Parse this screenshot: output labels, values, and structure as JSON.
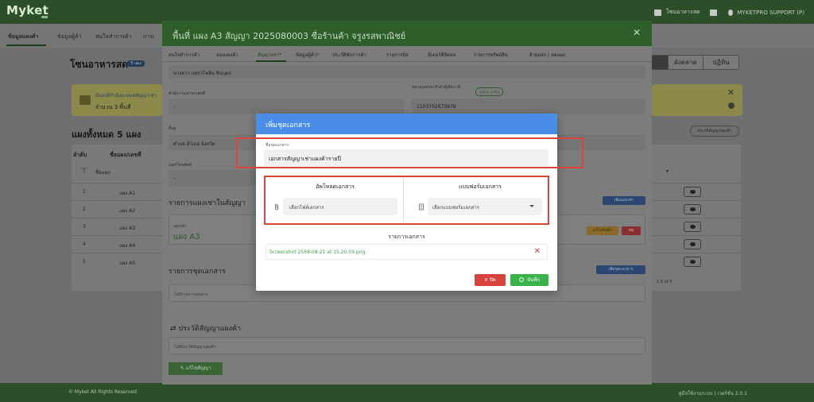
{
  "app": {
    "logo": "Myket",
    "user_label": "โซนอาหารสด",
    "account_label": "MYKETPRO SUPPORT (P)"
  },
  "page_tabs": [
    "ข้อมูลแผงค้า",
    "ข้อมูลผู้ค้า",
    "สนใจทำการค้า",
    "การเ"
  ],
  "page": {
    "title": "โซนอาหารสด",
    "badge": "5 แผง",
    "view_buttons": [
      "",
      "ผังตลาด",
      "ปฏิทิน"
    ],
    "banner_line1": "มีแผงที่กำลังจะหมดสัญญาเช่า",
    "banner_line2": "จำนวน 3 พื้นที่",
    "stalls_title": "แผงทั้งหมด 5 แผง",
    "history_button": "ประวัติสัญญาแผงค้า",
    "table_headers": [
      "ลำดับ",
      "ชื่อแผง/เลขที่"
    ],
    "filter_placeholder": "ชื่อแผง",
    "rows": [
      {
        "num": "1",
        "name": "แผง A1"
      },
      {
        "num": "2",
        "name": "แผง A2"
      },
      {
        "num": "3",
        "name": "แผง A3"
      },
      {
        "num": "4",
        "name": "แผง A4"
      },
      {
        "num": "5",
        "name": "แผง A5"
      }
    ],
    "paging": "1-5 of 5"
  },
  "footer": {
    "left": "© Myket All Rights Reserved",
    "right": "คู่มือใช้งานระบบ | เวอร์ชั่น 2.0.1"
  },
  "contract_modal": {
    "title": "พื้นที่ แผง A3 สัญญา 2025080003 ชื่อร้านค้า จรูงรสพาณิชย์",
    "tabs": [
      {
        "label": "สนใจทำการค้า",
        "star": false
      },
      {
        "label": "จองแผงค้า",
        "star": false
      },
      {
        "label": "สัญญาเช่า",
        "star": true
      },
      {
        "label": "ข้อมูลผู้ค้า",
        "star": true
      },
      {
        "label": "ประวัติพักการค้า",
        "star": false
      },
      {
        "label": "รายการบิล",
        "star": false
      },
      {
        "label": "มิเตอร์ดิจิตอล",
        "star": false
      },
      {
        "label": "รายการทรัพย์สิน",
        "star": false
      },
      {
        "label": "ย้ายออก / ลดแผง",
        "star": false
      }
    ],
    "tenant_name": "นางสาว แพรวไพลิน ชินบุตร",
    "office_label": "สำนักงาน/สาขาเลขที่",
    "office_value": "-",
    "id_label": "หมายเลขประจำตัวผู้เสียภาษี",
    "id_badge": "รูปแบบ ถูกต้อง",
    "id_value": "1103702673978",
    "address_label": "ที่อยู่",
    "address_value": "ตำบล อำเภอ จังหวัด",
    "phone_label": "เบอร์โทรศัพท์",
    "phone_value": "-",
    "stalls_section": "รายการแผงเช่าในสัญญา",
    "add_stall_button": "เพิ่มแผงเช่า",
    "stall_label": "แผงเช่า",
    "stall_name": "แผง A3",
    "stall_edit_button": "แก้ไขสินค้า",
    "stall_delete_button": "ลบ",
    "docs_section": "รายการชุดเอกสาร",
    "add_docs_button": "เพิ่มชุดเอกสาร",
    "docs_empty": "ไม่มีรายการเอกสาร",
    "history_section": "ประวัติสัญญาแผงค้า",
    "history_empty": "ไม่มีประวัติสัญญาแผงค้า",
    "edit_contract_button": "แก้ไขสัญญา"
  },
  "dialog": {
    "title": "เพิ่มชุดเอกสาร",
    "docname_label": "ชื่อชุดเอกสาร",
    "docname_value": "เอกสารสัญญาเช่าแผงค้ารายปี",
    "upload_heading": "อัพโหลดเอกสาร",
    "upload_placeholder": "เลือกไฟล์เอกสาร",
    "template_heading": "แบบฟอร์มเอกสาร",
    "template_placeholder": "เลือกแบบฟอร์มเอกสาร",
    "docs_heading": "รายการเอกสาร",
    "doc_file": "Screenshot 2568-08-21 at 15.20.59.png",
    "close_button": "ปิด",
    "save_button": "บันทึก"
  },
  "colors": {
    "header_blue": "#4a8de8",
    "highlight_red": "#e0433a",
    "save_green": "#39b44a",
    "close_red": "#d9433d",
    "brand_green": "#2c4f2a"
  }
}
